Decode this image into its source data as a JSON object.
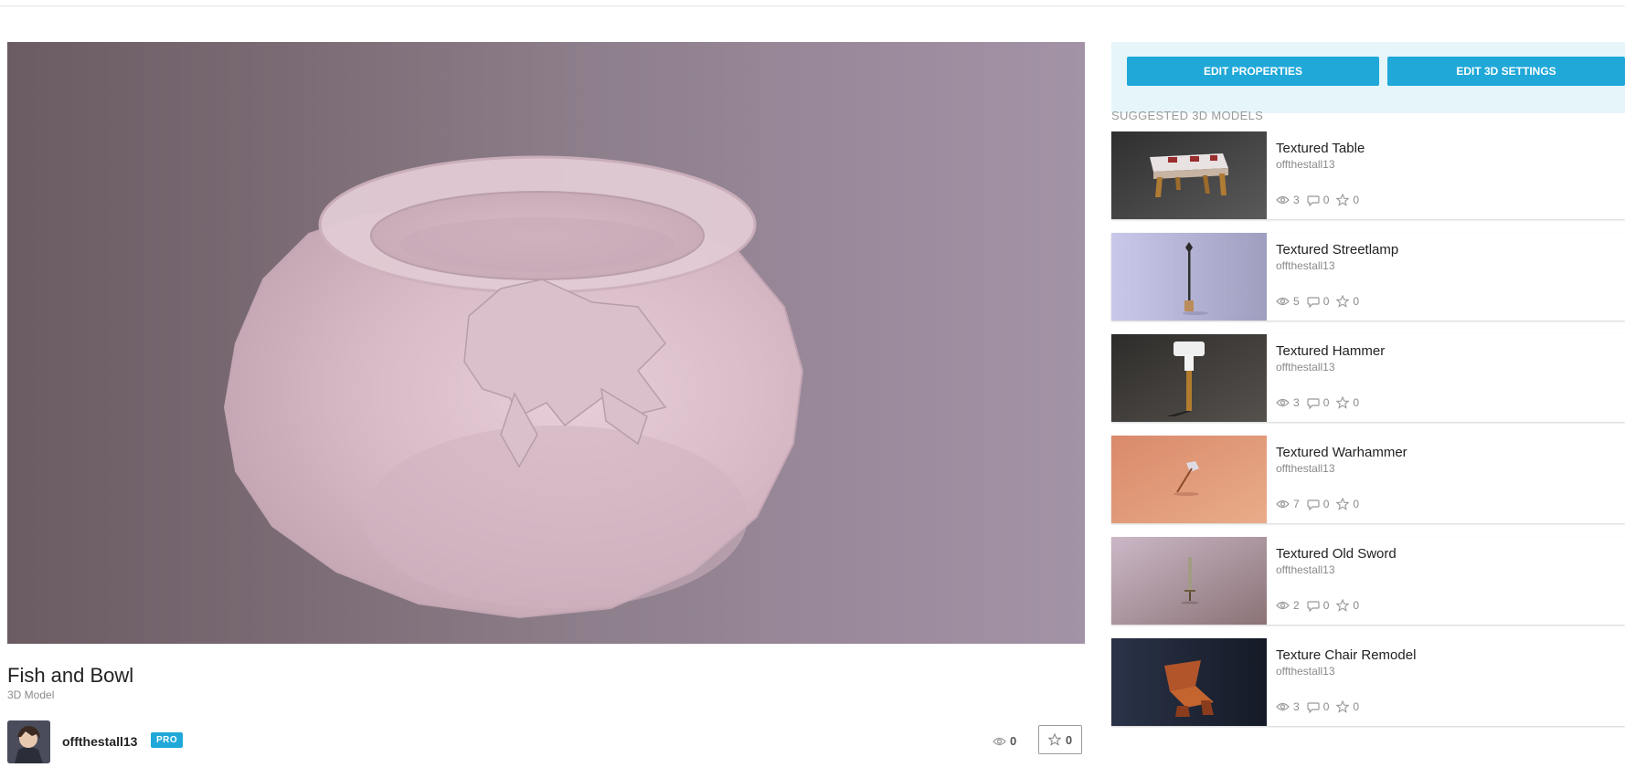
{
  "model": {
    "title": "Fish and Bowl",
    "type_label": "3D Model",
    "owner": "offthestall13",
    "badge": "PRO",
    "views": "0",
    "stars": "0"
  },
  "actions": {
    "edit_properties": "EDIT PROPERTIES",
    "edit_3d_settings": "EDIT 3D SETTINGS"
  },
  "suggested": {
    "heading": "SUGGESTED 3D MODELS",
    "items": [
      {
        "name": "Textured Table",
        "author": "offthestall13",
        "views": "3",
        "comments": "0",
        "stars": "0"
      },
      {
        "name": "Textured Streetlamp",
        "author": "offthestall13",
        "views": "5",
        "comments": "0",
        "stars": "0"
      },
      {
        "name": "Textured Hammer",
        "author": "offthestall13",
        "views": "3",
        "comments": "0",
        "stars": "0"
      },
      {
        "name": "Textured Warhammer",
        "author": "offthestall13",
        "views": "7",
        "comments": "0",
        "stars": "0"
      },
      {
        "name": "Textured Old Sword",
        "author": "offthestall13",
        "views": "2",
        "comments": "0",
        "stars": "0"
      },
      {
        "name": "Texture Chair Remodel",
        "author": "offthestall13",
        "views": "3",
        "comments": "0",
        "stars": "0"
      }
    ]
  },
  "colors": {
    "accent": "#1fa8d8",
    "action_panel_bg": "#e6f5fa",
    "muted_text": "#8a8a8a"
  },
  "icons": [
    "eye-icon",
    "comment-icon",
    "star-icon"
  ]
}
